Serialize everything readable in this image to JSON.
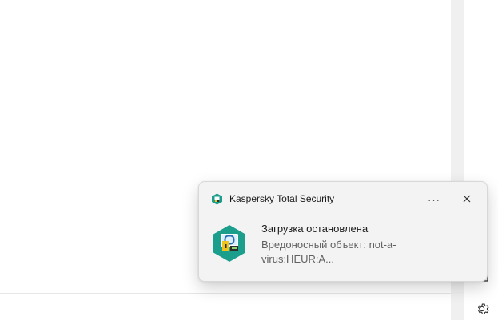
{
  "notification": {
    "app_name": "Kaspersky Total Security",
    "title": "Загрузка остановлена",
    "body": "Вредоносный объект: not-a-virus:HEUR:A...",
    "more_label": "···",
    "icons": {
      "app": "kaspersky-shield-icon",
      "hero": "kaspersky-blocked-download-icon",
      "more": "more-options-icon",
      "close": "close-icon"
    },
    "colors": {
      "brand_teal": "#1b9e8c",
      "lock_yellow": "#f2c31a"
    }
  },
  "taskbar_side": {
    "icons": {
      "partial": "window-icon",
      "settings": "gear-icon"
    }
  }
}
